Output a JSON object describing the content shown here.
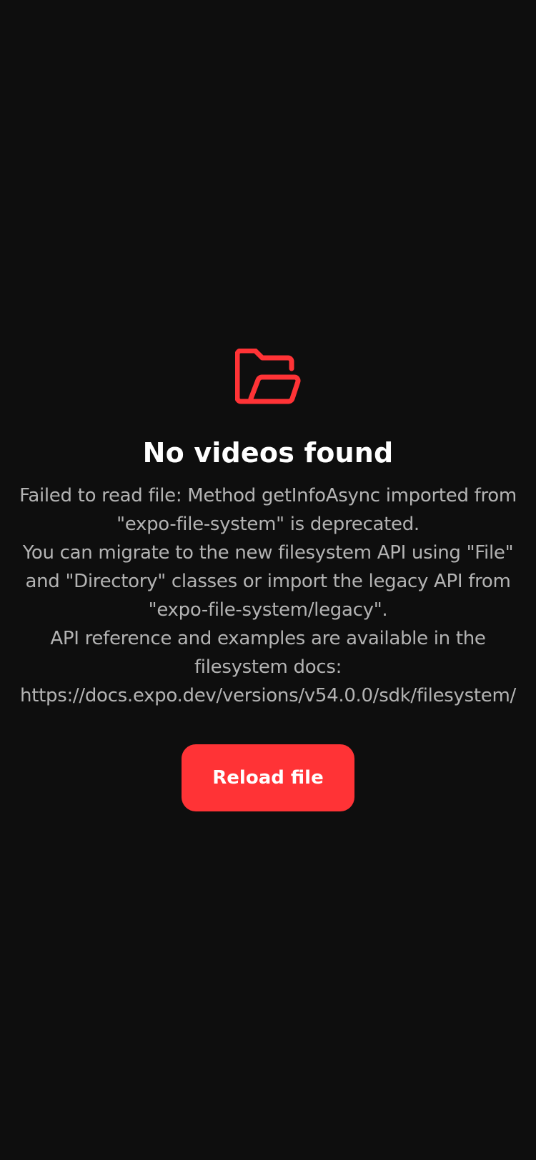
{
  "empty_state": {
    "icon": "folder-open-icon",
    "icon_color": "#ff3336",
    "title": "No videos found",
    "message": "Failed to read file: Method getInfoAsync imported from\n\"expo-file-system\" is deprecated.\nYou can migrate to the new filesystem API using \"File\"\nand \"Directory\" classes or import the legacy API from\n\"expo-file-system/legacy\".\nAPI reference and examples are available in the\nfilesystem docs:\nhttps://docs.expo.dev/versions/v54.0.0/sdk/filesystem/",
    "reload_label": "Reload file"
  },
  "colors": {
    "background": "#0e0e0e",
    "accent": "#ff3336",
    "title_text": "#ffffff",
    "body_text": "#b3b3b3"
  }
}
